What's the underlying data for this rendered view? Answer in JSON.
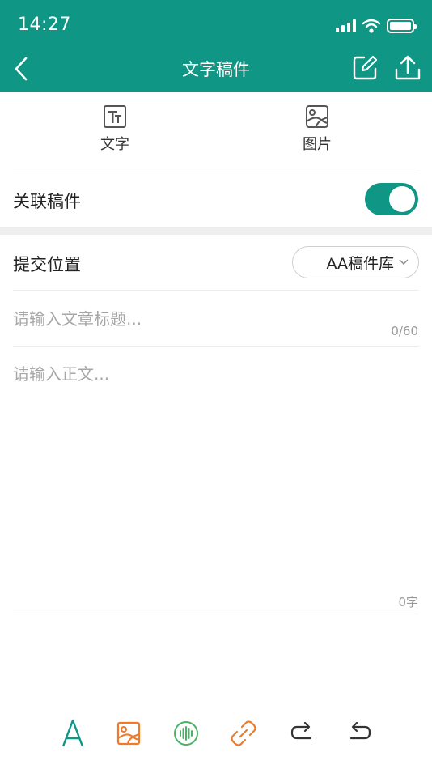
{
  "status_bar": {
    "time": "14:27"
  },
  "header": {
    "title": "文字稿件"
  },
  "tabs": [
    {
      "label": "文字",
      "icon": "text-format-icon"
    },
    {
      "label": "图片",
      "icon": "image-icon"
    }
  ],
  "link_row": {
    "label": "关联稿件",
    "toggle_on": true
  },
  "position_row": {
    "label": "提交位置",
    "selected": "AA稿件库"
  },
  "title_field": {
    "placeholder": "请输入文章标题...",
    "value": "",
    "counter": "0/60"
  },
  "body_field": {
    "placeholder": "请输入正文...",
    "value": "",
    "counter": "0字"
  },
  "toolbar": [
    {
      "icon": "font-icon",
      "color": "#0f9684"
    },
    {
      "icon": "insert-image-icon",
      "color": "#f07a2a"
    },
    {
      "icon": "audio-icon",
      "color": "#4bb368"
    },
    {
      "icon": "link-icon",
      "color": "#f07a2a"
    },
    {
      "icon": "redo-icon",
      "color": "#333333"
    },
    {
      "icon": "undo-icon",
      "color": "#333333"
    }
  ],
  "colors": {
    "accent": "#0f9684",
    "text": "#222222",
    "placeholder": "#a6a6a6"
  }
}
